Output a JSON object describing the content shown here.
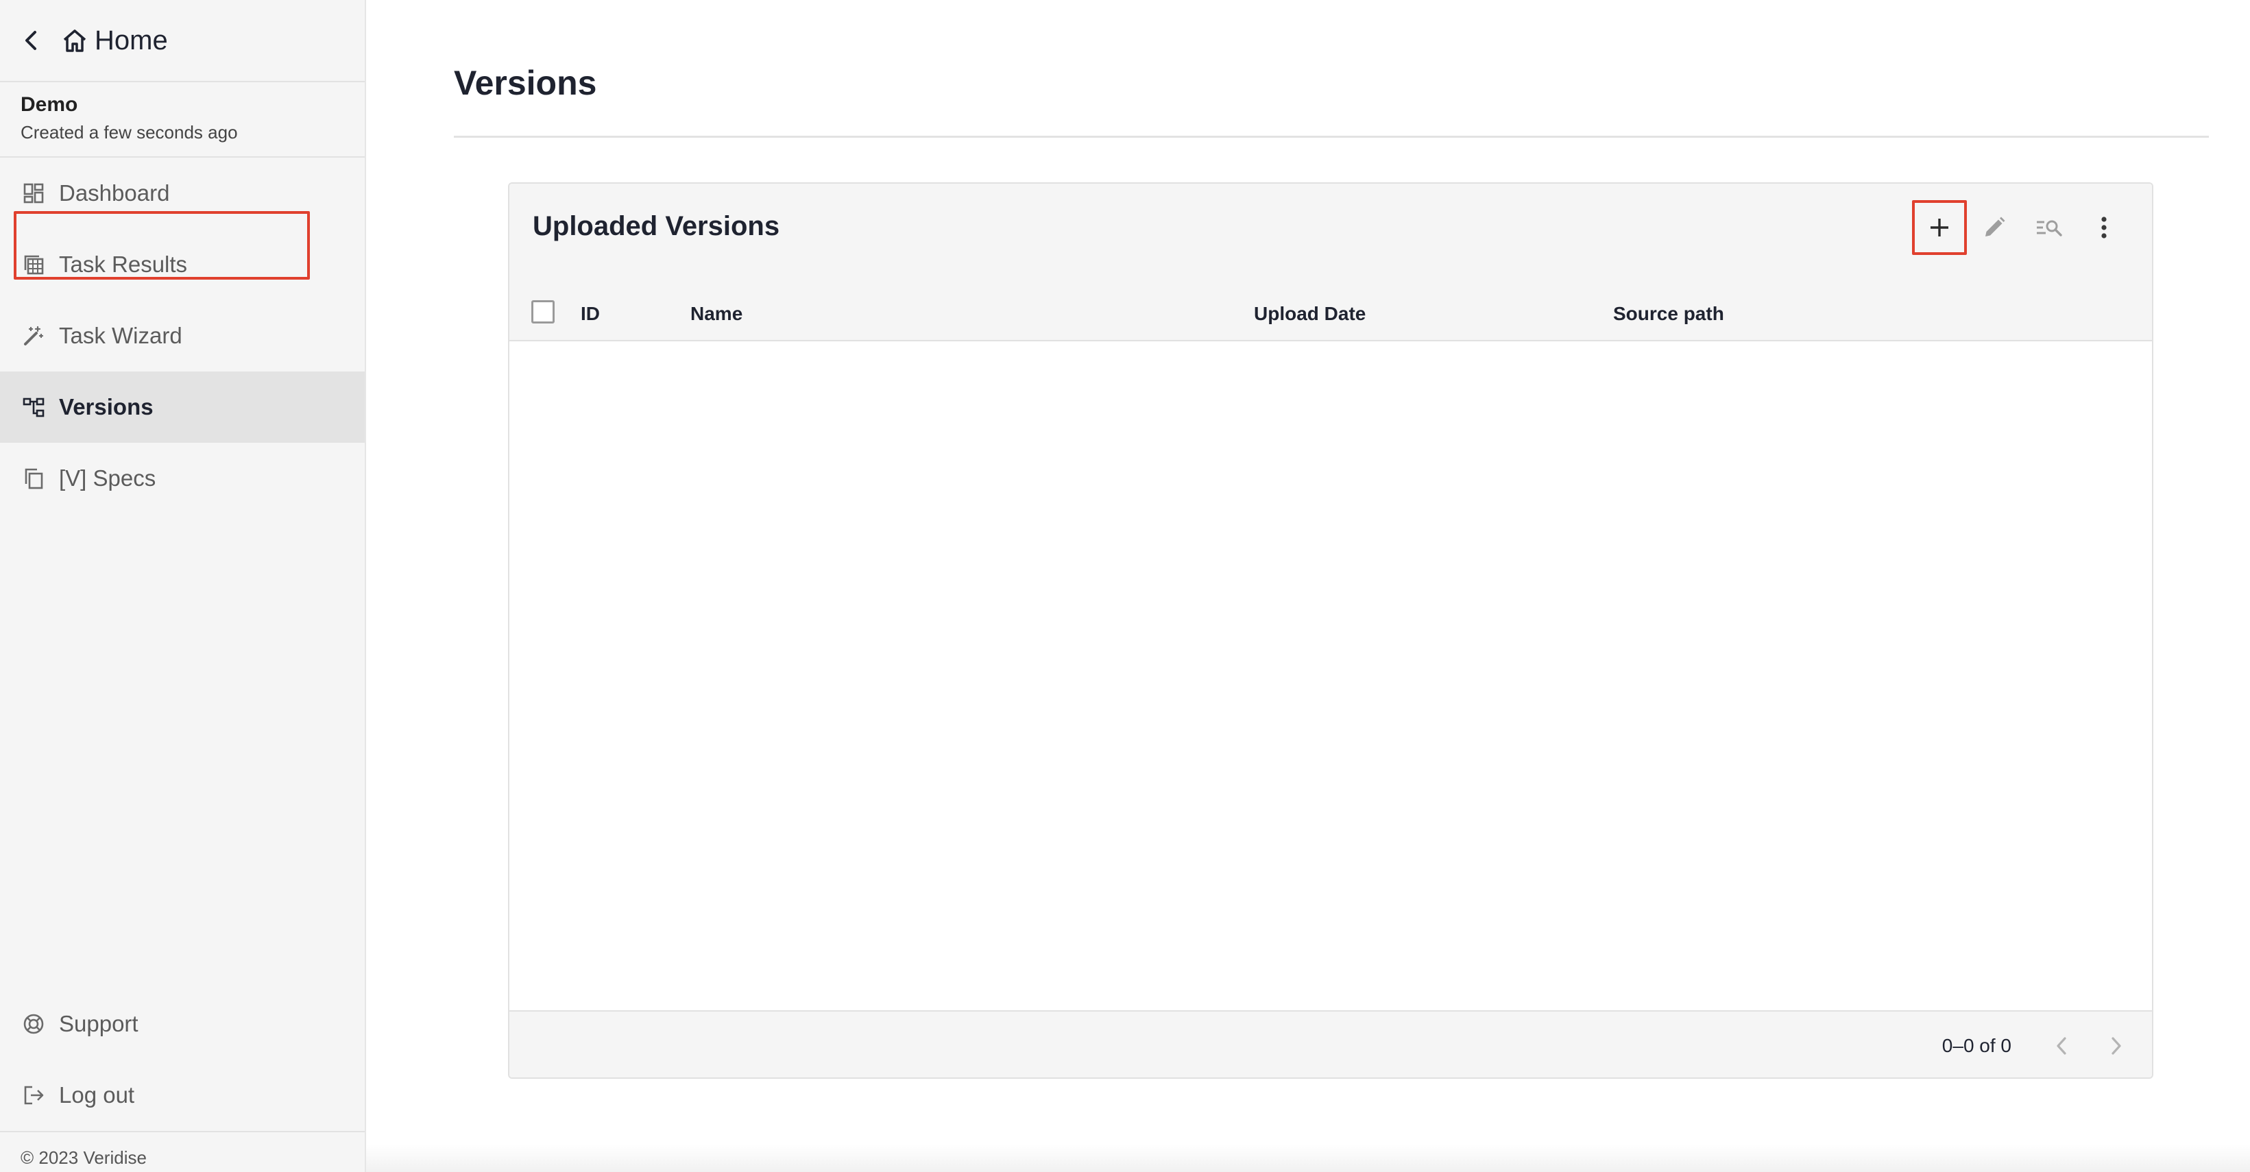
{
  "sidebar": {
    "home_label": "Home",
    "project": {
      "name": "Demo",
      "subtitle": "Created a few seconds ago"
    },
    "items": [
      {
        "label": "Dashboard",
        "icon": "dashboard-icon"
      },
      {
        "label": "Task Results",
        "icon": "task-results-icon"
      },
      {
        "label": "Task Wizard",
        "icon": "magic-wand-icon"
      },
      {
        "label": "Versions",
        "icon": "versions-tree-icon",
        "active": true
      },
      {
        "label": "[V] Specs",
        "icon": "copy-icon"
      }
    ],
    "bottom_items": [
      {
        "label": "Support",
        "icon": "support-lifebuoy-icon"
      },
      {
        "label": "Log out",
        "icon": "logout-icon"
      }
    ],
    "copyright": "© 2023 Veridise"
  },
  "main": {
    "title": "Versions",
    "card": {
      "title": "Uploaded Versions",
      "toolbar": [
        "add-icon",
        "edit-icon",
        "filter-search-icon",
        "more-vert-icon"
      ],
      "columns": [
        "ID",
        "Name",
        "Upload Date",
        "Source path"
      ],
      "rows": [],
      "pagination": "0–0 of 0"
    }
  },
  "colors": {
    "highlight": "#e0402e",
    "sidebar_bg": "#f5f5f5",
    "active_bg": "#e3e3e3",
    "text_dark": "#1f2330"
  }
}
